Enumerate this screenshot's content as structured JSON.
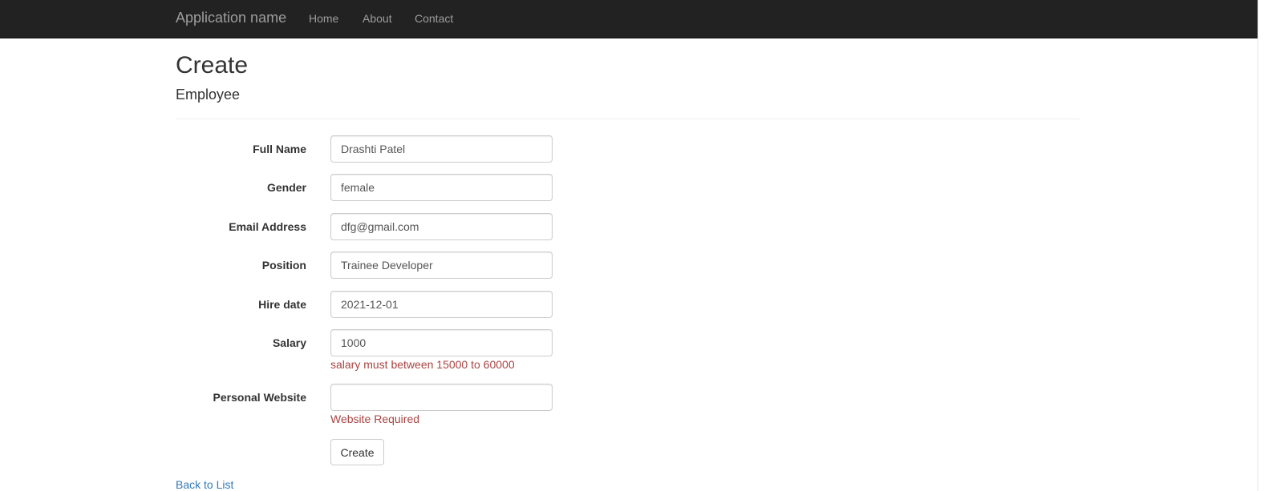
{
  "navbar": {
    "brand": "Application name",
    "links": [
      "Home",
      "About",
      "Contact"
    ]
  },
  "page": {
    "title": "Create",
    "subtitle": "Employee"
  },
  "form": {
    "fields": [
      {
        "label": "Full Name",
        "value": "Drashti Patel"
      },
      {
        "label": "Gender",
        "value": "female"
      },
      {
        "label": "Email Address",
        "value": "dfg@gmail.com"
      },
      {
        "label": "Position",
        "value": "Trainee Developer"
      },
      {
        "label": "Hire date",
        "value": "2021-12-01"
      },
      {
        "label": "Salary",
        "value": "1000",
        "error": "salary must between 15000 to 60000"
      },
      {
        "label": "Personal Website",
        "value": "",
        "error": "Website Required"
      }
    ],
    "submit_label": "Create"
  },
  "footer_link": "Back to List",
  "colors": {
    "navbar_bg": "#222222",
    "error": "#a94442",
    "link": "#337ab7"
  }
}
